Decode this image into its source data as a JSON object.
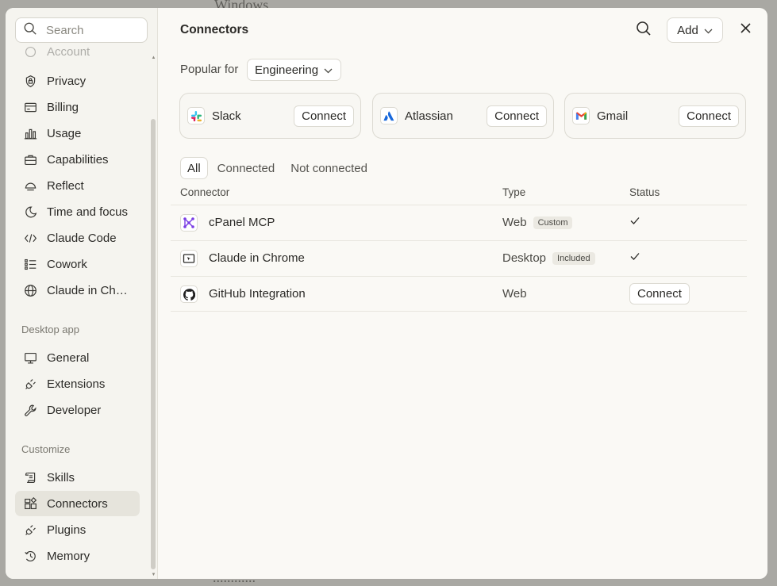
{
  "backdrop": {
    "top_text": "Windows",
    "bottom_text": "............"
  },
  "sidebar": {
    "search_placeholder": "Search",
    "items_top": [
      {
        "label": "Account",
        "icon": "account-icon"
      },
      {
        "label": "Privacy",
        "icon": "lock-icon"
      },
      {
        "label": "Billing",
        "icon": "card-icon"
      },
      {
        "label": "Usage",
        "icon": "bar-chart-icon"
      },
      {
        "label": "Capabilities",
        "icon": "briefcase-icon"
      },
      {
        "label": "Reflect",
        "icon": "reflect-icon"
      },
      {
        "label": "Time and focus",
        "icon": "moon-icon"
      },
      {
        "label": "Claude Code",
        "icon": "code-icon"
      },
      {
        "label": "Cowork",
        "icon": "list-icon"
      },
      {
        "label": "Claude in Chrome",
        "icon": "globe-icon"
      }
    ],
    "section_desktop": "Desktop app",
    "items_desktop": [
      {
        "label": "General",
        "icon": "monitor-icon"
      },
      {
        "label": "Extensions",
        "icon": "plug-icon"
      },
      {
        "label": "Developer",
        "icon": "wrench-icon"
      }
    ],
    "section_customize": "Customize",
    "items_customize": [
      {
        "label": "Skills",
        "icon": "scroll-icon"
      },
      {
        "label": "Connectors",
        "icon": "connectors-icon",
        "active": true
      },
      {
        "label": "Plugins",
        "icon": "plug-icon"
      },
      {
        "label": "Memory",
        "icon": "memory-icon"
      }
    ]
  },
  "header": {
    "title": "Connectors",
    "add_label": "Add"
  },
  "popular": {
    "label": "Popular for",
    "selected": "Engineering",
    "cards": [
      {
        "name": "Slack",
        "button": "Connect",
        "icon": "slack-icon"
      },
      {
        "name": "Atlassian",
        "button": "Connect",
        "icon": "atlassian-icon"
      },
      {
        "name": "Gmail",
        "button": "Connect",
        "icon": "gmail-icon"
      }
    ]
  },
  "tabs": [
    "All",
    "Connected",
    "Not connected"
  ],
  "table": {
    "headers": {
      "connector": "Connector",
      "type": "Type",
      "status": "Status"
    },
    "rows": [
      {
        "name": "cPanel MCP",
        "type": "Web",
        "badge": "Custom",
        "status": "connected",
        "icon": "cpanel-icon"
      },
      {
        "name": "Claude in Chrome",
        "type": "Desktop",
        "badge": "Included",
        "status": "connected",
        "icon": "chrome-ext-icon"
      },
      {
        "name": "GitHub Integration",
        "type": "Web",
        "badge": "",
        "status": "Connect",
        "icon": "github-icon"
      }
    ]
  },
  "colors": {
    "accent_purple": "#7b3fe4",
    "atlassian_blue": "#1868db",
    "active_bg": "#e6e4dc"
  }
}
